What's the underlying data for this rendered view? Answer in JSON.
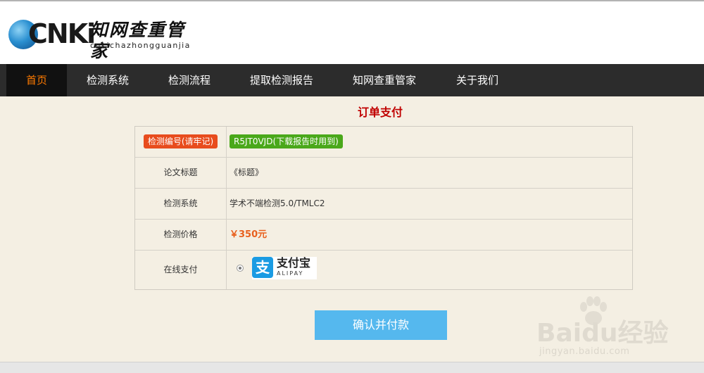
{
  "brand": {
    "logo_text": "CNKi",
    "name_cn": "知网查重管家",
    "pinyin": "cnkichazhongguanjia"
  },
  "nav": {
    "items": [
      {
        "label": "首页",
        "active": true
      },
      {
        "label": "检测系统",
        "active": false
      },
      {
        "label": "检测流程",
        "active": false
      },
      {
        "label": "提取检测报告",
        "active": false
      },
      {
        "label": "知网查重管家",
        "active": false
      },
      {
        "label": "关于我们",
        "active": false
      }
    ]
  },
  "page": {
    "title": "订单支付"
  },
  "order": {
    "id_label": "检测编号(请牢记)",
    "id_value": "R5JT0VJD(下载报告时用到)",
    "rows": [
      {
        "label": "论文标题",
        "value": "《标题》"
      },
      {
        "label": "检测系统",
        "value": "学术不端检测5.0/TMLC2"
      },
      {
        "label": "检测价格",
        "value": "￥350元"
      }
    ],
    "payment_label": "在线支付",
    "payment_method": {
      "name": "支付宝",
      "sub": "ALIPAY",
      "icon_char": "支",
      "selected": true
    }
  },
  "actions": {
    "confirm_label": "确认并付款"
  },
  "watermark": {
    "brand": "Baidu经验",
    "domain": "jingyan.baidu.com"
  },
  "colors": {
    "accent": "#ff7a00",
    "title_red": "#c00000",
    "tag_red": "#e84c1d",
    "tag_green": "#4aa81a",
    "price": "#e8601e",
    "button": "#55b8ee",
    "nav_bg": "#2c2c2c",
    "alipay_blue": "#1a9be3"
  }
}
